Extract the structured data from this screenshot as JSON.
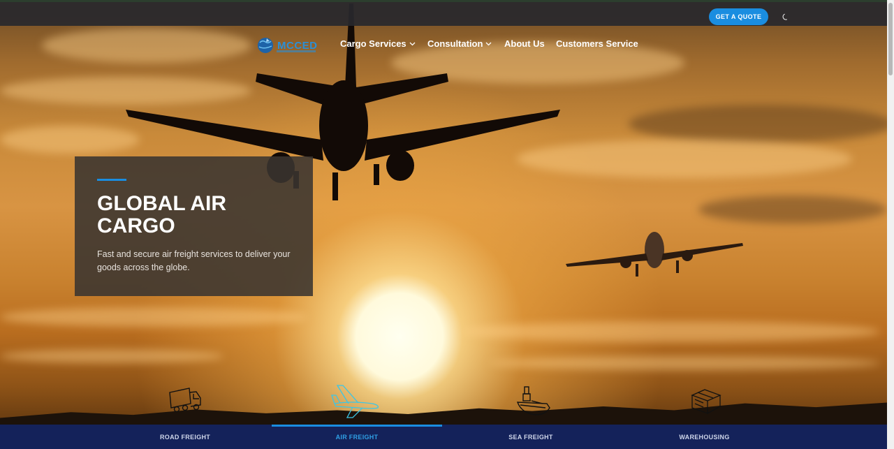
{
  "topbar": {
    "quote_label": "GET A QUOTE",
    "theme_icon": "moon-icon"
  },
  "nav": {
    "logo_text": "MCCED",
    "items": [
      {
        "label": "Cargo Services",
        "has_dropdown": true
      },
      {
        "label": "Consultation",
        "has_dropdown": true
      },
      {
        "label": "About Us",
        "has_dropdown": false
      },
      {
        "label": "Customers Service",
        "has_dropdown": false
      }
    ]
  },
  "hero": {
    "title": "GLOBAL AIR CARGO",
    "description": "Fast and secure air freight services to deliver your goods across the globe."
  },
  "services": {
    "icons": [
      "truck-icon",
      "airplane-icon",
      "ship-icon",
      "warehouse-icon"
    ],
    "tabs": [
      {
        "label": "ROAD FREIGHT",
        "active": false
      },
      {
        "label": "AIR FREIGHT",
        "active": true
      },
      {
        "label": "SEA FREIGHT",
        "active": false
      },
      {
        "label": "WAREHOUSING",
        "active": false
      }
    ]
  },
  "colors": {
    "accent": "#1a8de0",
    "tabbar": "#14225a",
    "active_tab": "#2fa0e6"
  }
}
